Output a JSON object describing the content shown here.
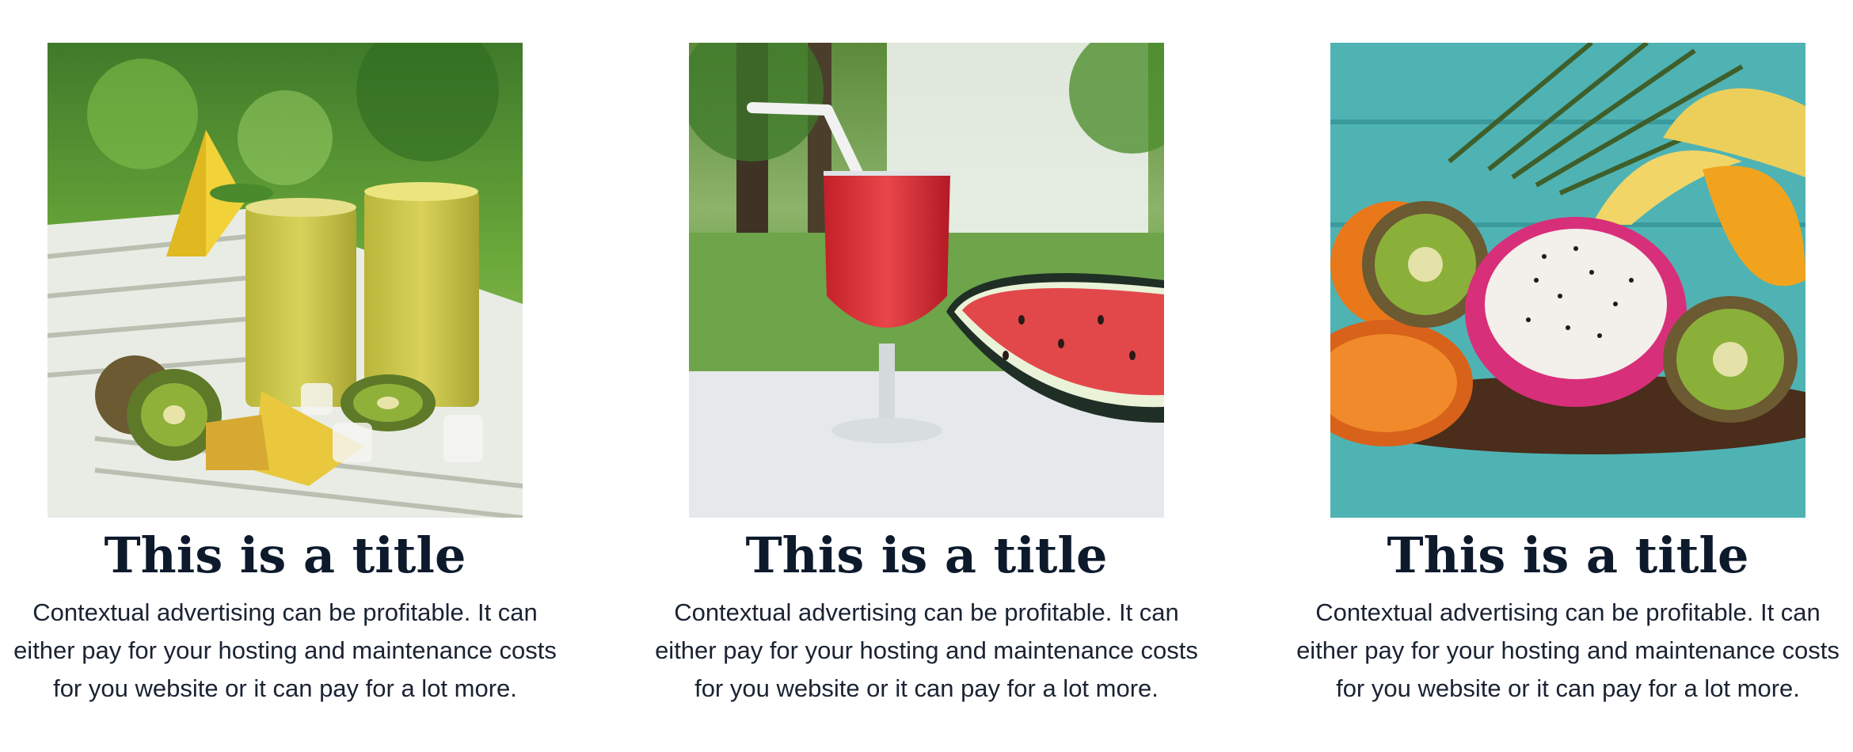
{
  "cards": [
    {
      "image_alt": "smoothies-kiwi-pineapple-photo",
      "title": "This is a title",
      "text": "Contextual advertising can be profitable. It can either pay for your hosting and maintenance costs for you website or it can pay for a lot more."
    },
    {
      "image_alt": "watermelon-juice-photo",
      "title": "This is a title",
      "text": "Contextual advertising can be profitable. It can either pay for your hosting and maintenance costs for you website or it can pay for a lot more."
    },
    {
      "image_alt": "tropical-fruit-platter-photo",
      "title": "This is a title",
      "text": "Contextual advertising can be profitable. It can either pay for your hosting and maintenance costs for you website or it can pay for a lot more."
    }
  ],
  "colors": {
    "title": "#0d1a2c",
    "text": "#1a2333",
    "background": "#ffffff"
  }
}
